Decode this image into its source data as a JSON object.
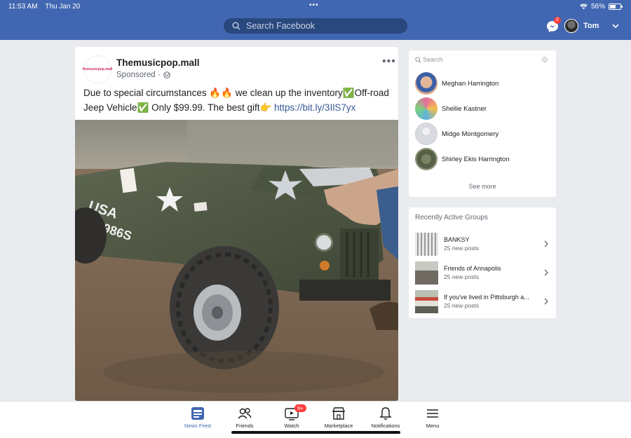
{
  "status_bar": {
    "time": "11:53 AM",
    "date": "Thu Jan 20",
    "dots": "•••",
    "battery": "56%"
  },
  "header": {
    "search_placeholder": "Search Facebook",
    "messenger_badge": "2",
    "user_name": "Tom"
  },
  "post": {
    "page_name": "Themusicpop.mall",
    "logo_text": "themusicpop.mall",
    "sponsored": "Sponsored ·",
    "more": "•••",
    "text": "Due to special circumstances 🔥🔥 we clean up the inventory✅Off-road Jeep Vehicle✅ Only $99.99. The best gift👉 ",
    "link": "https://bit.ly/3IlS7yx",
    "image_text_line1": "USA",
    "image_text_line2": "206986S"
  },
  "contacts": {
    "search_placeholder": "Search",
    "items": [
      {
        "name": "Meghan Harrington"
      },
      {
        "name": "Shellie Kastner"
      },
      {
        "name": "Midge Montgomery"
      },
      {
        "name": "Shirley Ekis Harrington"
      }
    ],
    "see_more": "See more"
  },
  "groups": {
    "title": "Recently Active Groups",
    "items": [
      {
        "name": "BANKSY",
        "posts": "25 new posts"
      },
      {
        "name": "Friends of Annapolis",
        "posts": "25 new posts"
      },
      {
        "name": "If you've lived in Pittsburgh a...",
        "posts": "25 new posts"
      }
    ]
  },
  "tabs": [
    {
      "label": "News Feed",
      "icon": "news-feed-icon",
      "active": true
    },
    {
      "label": "Friends",
      "icon": "friends-icon"
    },
    {
      "label": "Watch",
      "icon": "watch-icon",
      "badge": "9+"
    },
    {
      "label": "Marketplace",
      "icon": "marketplace-icon"
    },
    {
      "label": "Notifications",
      "icon": "bell-icon"
    },
    {
      "label": "Menu",
      "icon": "menu-icon"
    }
  ],
  "colors": {
    "brand": "#4267b2",
    "badge": "#fa3e3e",
    "link": "#385898"
  }
}
